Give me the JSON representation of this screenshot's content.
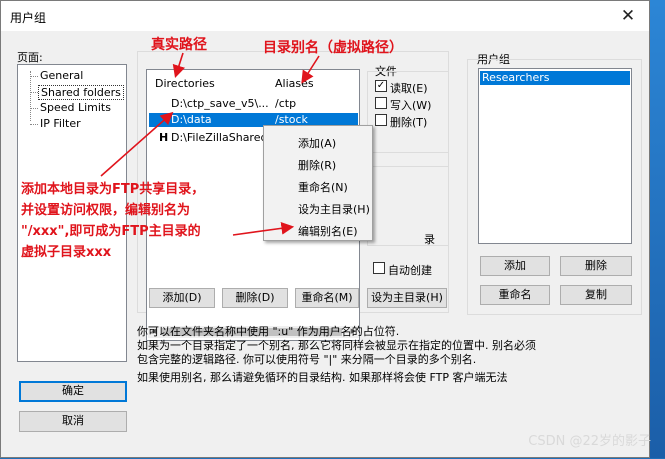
{
  "window": {
    "title": "用户组",
    "close_glyph": "✕"
  },
  "pages": {
    "label": "页面:",
    "items": [
      "General",
      "Shared folders",
      "Speed Limits",
      "IP Filter"
    ],
    "selected": "Shared folders"
  },
  "folders": {
    "headers": {
      "directories": "Directories",
      "aliases": "Aliases"
    },
    "rows": [
      {
        "prefix": "",
        "dir": "D:\\ctp_save_v5\\...",
        "alias": "/ctp"
      },
      {
        "prefix": "",
        "dir": "D:\\data",
        "alias": "/stock"
      },
      {
        "prefix": "H",
        "dir": "D:\\FileZillaShared...",
        "alias": ""
      }
    ],
    "selected_row": 1,
    "buttons": {
      "add": "添加(D)",
      "delete": "删除(D)",
      "rename": "重命名(M)",
      "set_home": "设为主目录(H)"
    }
  },
  "files": {
    "label": "文件",
    "options": [
      {
        "label": "读取(E)",
        "checked": true
      },
      {
        "label": "写入(W)",
        "checked": false
      },
      {
        "label": "删除(T)",
        "checked": false
      }
    ]
  },
  "dirs": {
    "partial_label": "录",
    "autocreate_label": "自动创建"
  },
  "context_menu": {
    "items": [
      "添加(A)",
      "删除(R)",
      "重命名(N)",
      "设为主目录(H)",
      "编辑别名(E)"
    ]
  },
  "groups": {
    "label": "用户组",
    "items": [
      "Researchers"
    ],
    "buttons": {
      "add": "添加",
      "delete": "删除",
      "rename": "重命名",
      "copy": "复制"
    }
  },
  "annotations": {
    "real_path": "真实路径",
    "alias_path": "目录别名（虚拟路径）",
    "note_lines": [
      "添加本地目录为FTP共享目录，",
      "并设置访问权限，编辑别名为",
      "\"/xxx\",即可成为FTP主目录的",
      "虚拟子目录xxx"
    ]
  },
  "help_text": [
    "你可以在文件夹名称中使用 \":u\" 作为用户名的占位符.",
    "如果为一个目录指定了一个别名, 那么它将同样会被显示在指定的位置中. 别名必须",
    "包含完整的逻辑路径. 你可以使用符号 \"|\" 来分隔一个目录的多个别名.",
    "如果使用别名, 那么请避免循环的目录结构. 如果那样将会使 FTP 客户端无法"
  ],
  "dialog_buttons": {
    "ok": "确定",
    "cancel": "取消"
  },
  "watermark": "CSDN @22岁的影子",
  "colors": {
    "selection": "#0078d7",
    "annotation_red": "#e0141c",
    "desktop": "#1f6fb8"
  }
}
